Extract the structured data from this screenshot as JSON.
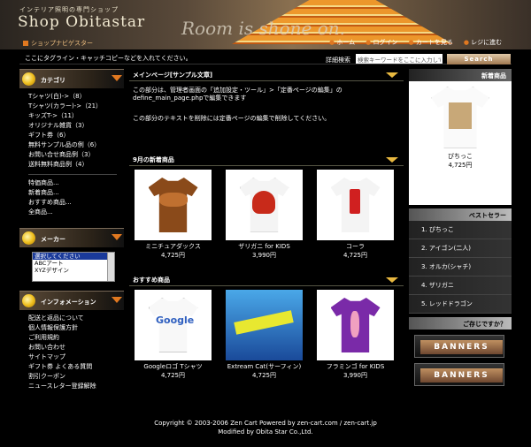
{
  "header": {
    "tagline": "インテリア照明の専門ショップ",
    "logo": "Shop Obitastar",
    "slogan_image": "Room is shone on.",
    "breadcrumb": "ショップナビゲスター",
    "nav": [
      "ホーム",
      "ログイン",
      "カートを見る",
      "レジに進む"
    ]
  },
  "bar": {
    "catch": "ここにタグライン・キャッチコピーなどを入れてください。",
    "search_label": "詳細検索",
    "search_placeholder": "検索キーワードをここに入力して",
    "search_button": "Search"
  },
  "left": {
    "category": {
      "title": "カテゴリ",
      "items": [
        "Tシャツ(白)->（8）",
        "Tシャツ(カラー)->（21）",
        "キッズT->（11）",
        "オリジナル雑貨（3）",
        "ギフト券（6）",
        "無料サンプル品の例（6）",
        "お問い合せ商品例（3）",
        "送料無料商品例（4）"
      ],
      "items2": [
        "特価商品...",
        "新着商品...",
        "おすすめ商品...",
        "全商品..."
      ]
    },
    "maker": {
      "title": "メーカー",
      "options": [
        "選択してください",
        "ABCアート",
        "XYZデザイン"
      ]
    },
    "info": {
      "title": "インフォメーション",
      "items": [
        "配送と返品について",
        "個人情報保護方針",
        "ご利用規約",
        "お問い合わせ",
        "サイトマップ",
        "ギフト券 よくある質問",
        "割引クーポン",
        "ニュースレター登録解除"
      ]
    }
  },
  "center": {
    "main": {
      "title": "メインページ[サンプル文章]",
      "p1": "この部分は、管理者画面の「追加設定・ツール」>「定番ページの編集」の define_main_page.phpで編集できます",
      "p2": "この部分のテキストを削除には定番ページの編集で削除してください。"
    },
    "new": {
      "title": "9月の新着商品",
      "products": [
        {
          "name": "ミニチュアダックス",
          "price": "4,725円"
        },
        {
          "name": "ザリガニ for KIDS",
          "price": "3,990円"
        },
        {
          "name": "コーラ",
          "price": "4,725円"
        }
      ]
    },
    "featured": {
      "title": "おすすめ商品",
      "products": [
        {
          "name": "Googleロゴ Tシャツ",
          "price": "4,725円"
        },
        {
          "name": "Extream Cat(サーフィン)",
          "price": "4,725円"
        },
        {
          "name": "フラミンゴ for KIDS",
          "price": "3,990円"
        }
      ]
    }
  },
  "right": {
    "new": {
      "title": "新着商品",
      "name": "ぴちっこ",
      "price": "4,725円"
    },
    "best": {
      "title": "ベストセラー",
      "items": [
        "1.  ぴちっこ",
        "2.  アイゴン(二人)",
        "3.  オルカ(シャチ)",
        "4.  ザリガニ",
        "5.  レッドドラゴン"
      ]
    },
    "banner_title": "ご存じですか？",
    "banners": [
      "BANNERS",
      "BANNERS"
    ]
  },
  "footer": {
    "line1": "Copyright © 2003-2006 Zen Cart Powered by zen-cart.com / zen-cart.jp",
    "line2": "Modified by Obita Star Co.,Ltd."
  }
}
